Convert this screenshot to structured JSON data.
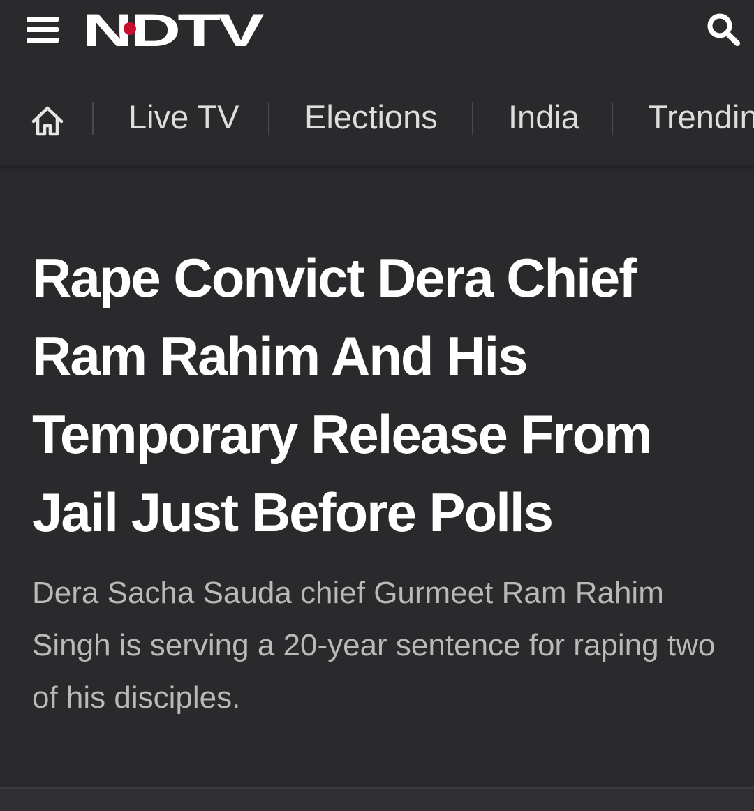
{
  "header": {
    "logo_text": "NDTV",
    "menu_icon": "hamburger-menu-icon",
    "search_icon": "search-icon",
    "colors": {
      "background": "#2a2a2c",
      "logo": "#ffffff",
      "logo_dot": "#c8102e"
    }
  },
  "nav": {
    "home_icon": "home-icon",
    "items": [
      {
        "label": "Live TV"
      },
      {
        "label": "Elections"
      },
      {
        "label": "India"
      },
      {
        "label": "Trending"
      }
    ]
  },
  "article": {
    "headline": "Rape Convict Dera Chief Ram Rahim And His Temporary Release From Jail Just Before Polls",
    "summary": "Dera Sacha Sauda chief Gurmeet Ram Rahim Singh is serving a 20-year sentence for raping two of his disciples."
  }
}
